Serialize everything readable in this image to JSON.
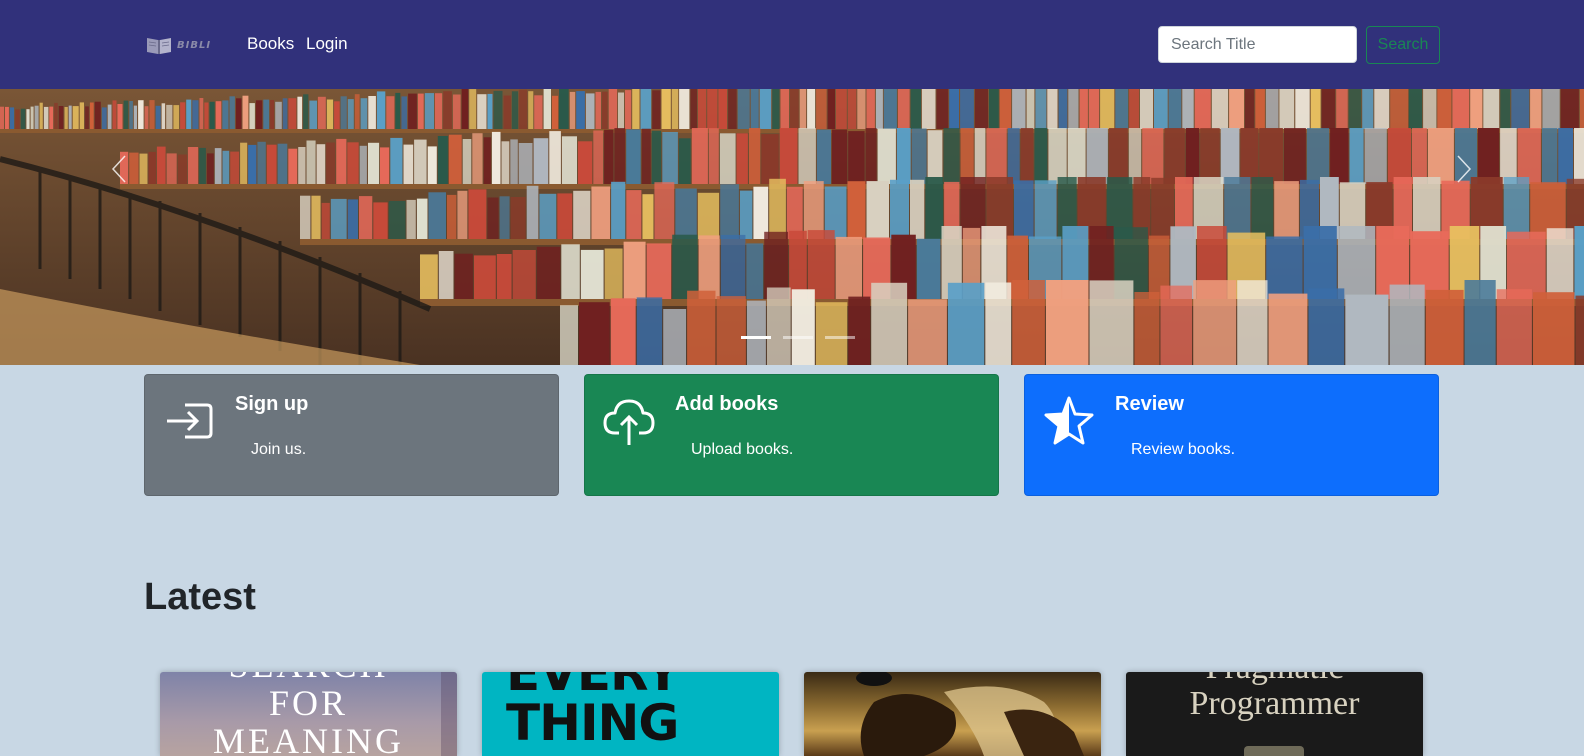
{
  "navbar": {
    "logo_text": "BIBLI",
    "links": [
      {
        "label": "Books"
      },
      {
        "label": "Login"
      }
    ],
    "search": {
      "placeholder": "Search Title",
      "value": "",
      "button_label": "Search"
    }
  },
  "carousel": {
    "slide_count": 3,
    "active_index": 0
  },
  "features": [
    {
      "title": "Sign up",
      "text": "Join us.",
      "icon": "sign-in-icon",
      "color": "#6c757d"
    },
    {
      "title": "Add books",
      "text": "Upload books.",
      "icon": "cloud-upload-icon",
      "color": "#198754"
    },
    {
      "title": "Review",
      "text": "Review books.",
      "icon": "star-half-icon",
      "color": "#0d6efd"
    }
  ],
  "latest": {
    "heading": "Latest",
    "books": [
      {
        "cover_text": "SEARCH\nFOR\nMEANING",
        "color": "#8a87a8"
      },
      {
        "cover_text": "EVERY\nTHING",
        "color": "#00b5c2"
      },
      {
        "cover_text": "",
        "color": "#8a6a30"
      },
      {
        "cover_text": "Pragmatic\nProgrammer",
        "color": "#1a1a1a"
      }
    ]
  },
  "colors": {
    "navbar": "#31317b",
    "page_background": "#c8d7e4",
    "success": "#198754",
    "primary": "#0d6efd",
    "secondary": "#6c757d"
  }
}
